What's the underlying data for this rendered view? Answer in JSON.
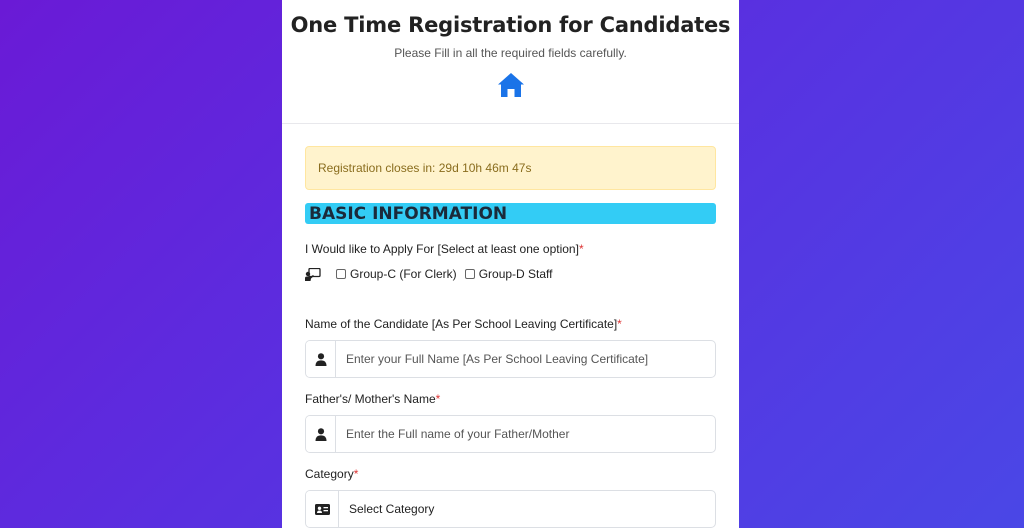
{
  "header": {
    "title": "One Time Registration for Candidates",
    "subtitle": "Please Fill in all the required fields carefully."
  },
  "alert": {
    "text": "Registration closes in: 29d 10h 46m 47s"
  },
  "section": {
    "title": "BASIC INFORMATION"
  },
  "apply": {
    "label": "I Would like to Apply For [Select at least one option]",
    "options": [
      "Group-C (For Clerk)",
      "Group-D Staff"
    ]
  },
  "fields": {
    "candidate_name": {
      "label": "Name of the Candidate [As Per School Leaving Certificate]",
      "placeholder": "Enter your Full Name [As Per School Leaving Certificate]"
    },
    "parent_name": {
      "label": "Father's/ Mother's Name",
      "placeholder": "Enter the Full name of your Father/Mother"
    },
    "category": {
      "label": "Category",
      "selected": "Select Category"
    }
  },
  "required_mark": "*",
  "colors": {
    "accent": "#1a73e8",
    "section": "#33ccf5",
    "alert_bg": "#fff3cd"
  },
  "icons": {
    "home": "home-icon",
    "person": "person-icon",
    "id_card": "id-card-icon",
    "chalkboard": "chalkboard-teacher-icon"
  }
}
